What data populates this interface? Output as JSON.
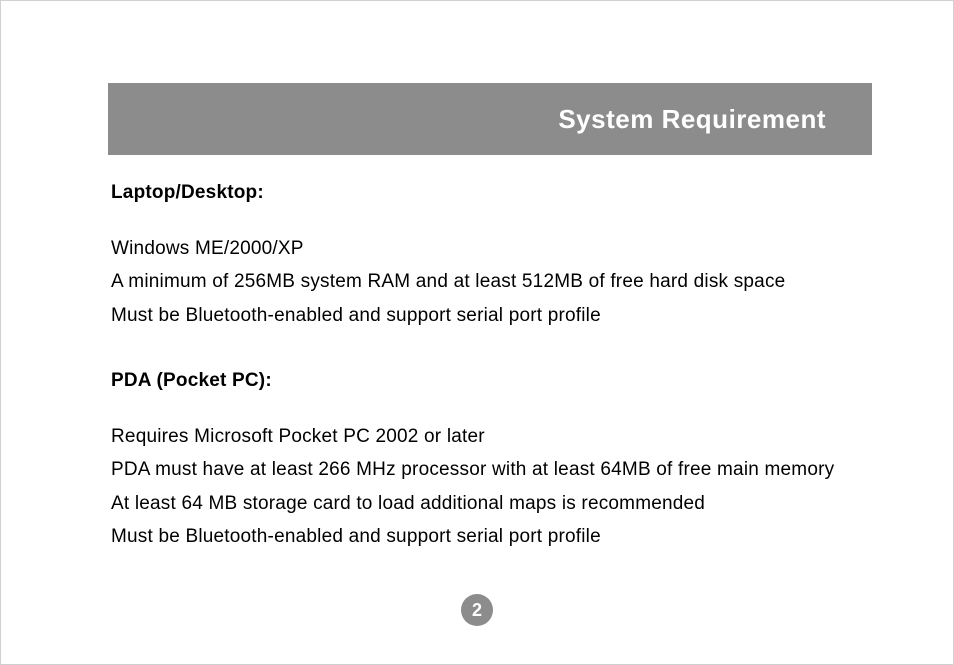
{
  "header": {
    "title": "System Requirement"
  },
  "sections": {
    "laptop_heading": "Laptop/Desktop:",
    "laptop_line1": "Windows ME/2000/XP",
    "laptop_line2": "A minimum of 256MB system RAM and at least 512MB of free hard disk space",
    "laptop_line3": "Must be Bluetooth-enabled and support serial port profile",
    "pda_heading": "PDA (Pocket PC):",
    "pda_line1": "Requires Microsoft Pocket PC 2002 or later",
    "pda_line2": "PDA must have at least 266 MHz processor with at least 64MB of free main memory",
    "pda_line3": "At least 64 MB storage card to load additional maps is recommended",
    "pda_line4": "Must be Bluetooth-enabled and support serial port profile"
  },
  "page_number": "2"
}
